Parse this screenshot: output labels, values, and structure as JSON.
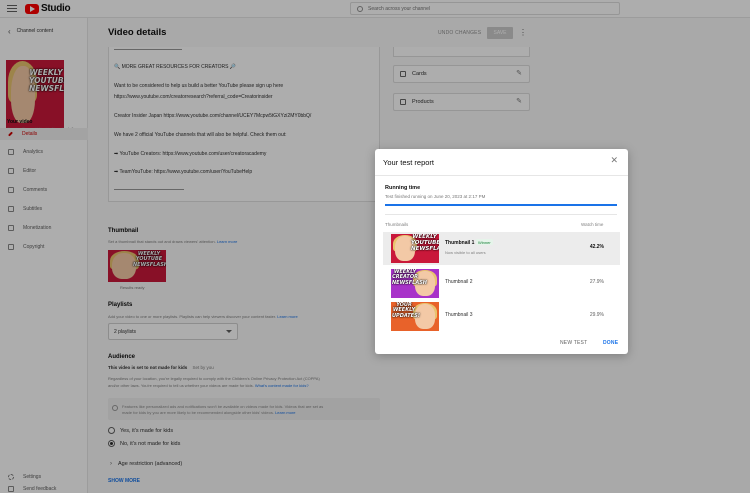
{
  "app": {
    "logo_text": "Studio",
    "search_placeholder": "Search across your channel"
  },
  "sidebar": {
    "back_label": "Channel content",
    "your_video": "Your video",
    "channel_name": "Creator Channel Weekly Newsflash & Updates",
    "items": [
      {
        "label": "Details",
        "icon": "pencil-icon"
      },
      {
        "label": "Analytics",
        "icon": "analytics-icon"
      },
      {
        "label": "Editor",
        "icon": "editor-icon"
      },
      {
        "label": "Comments",
        "icon": "comments-icon"
      },
      {
        "label": "Subtitles",
        "icon": "subtitles-icon"
      },
      {
        "label": "Monetization",
        "icon": "monetization-icon"
      },
      {
        "label": "Copyright",
        "icon": "copyright-icon"
      }
    ],
    "settings": "Settings",
    "feedback": "Send feedback"
  },
  "header": {
    "title": "Video details",
    "undo": "UNDO CHANGES",
    "save": "SAVE"
  },
  "description_lines": [
    "🔍 MORE GREAT RESOURCES FOR CREATORS 🔎",
    "Want to be considered to help us build a better YouTube please sign up here",
    "https://www.youtube.com/creatorresearch?referral_code=Creatorinsider",
    "Creator Insider Japan https://www.youtube.com/channel/UCEY7Mcpw5tGXYzi2MY0bbQ/",
    "We have 2 official YouTube channels that will also be helpful. Check them out:",
    "➡ YouTube Creators: https://www.youtube.com/user/creatoracademy",
    "➡ TeamYouTube: https://www.youtube.com/user/YouTubeHelp"
  ],
  "thumbnail": {
    "title": "Thumbnail",
    "desc": "Set a thumbnail that stands out and draws viewers' attention.",
    "learn_more": "Learn more",
    "caption": "Results ready",
    "text": "WEEKLY YOUTUBE NEWSFLASH"
  },
  "playlists": {
    "title": "Playlists",
    "desc": "Add your video to one or more playlists. Playlists can help viewers discover your content faster.",
    "learn_more": "Learn more",
    "selected": "2 playlists"
  },
  "audience": {
    "title": "Audience",
    "status": "This video is set to not made for kids",
    "set_by": "Set by you",
    "desc_line1": "Regardless of your location, you're legally required to comply with the Children's Online Privacy Protection Act (COPPA)",
    "desc_line2": "and/or other laws. You're required to tell us whether your videos are made for kids.",
    "desc_link": "What's content made for kids?",
    "notice_line1": "Features like personalized ads and notifications won't be available on videos made for kids. Videos that are set as",
    "notice_line2": "made for kids by you are more likely to be recommended alongside other kids' videos.",
    "notice_link": "Learn more",
    "option_yes": "Yes, it's made for kids",
    "option_no": "No, it's not made for kids",
    "age_restriction": "Age restriction (advanced)",
    "show_more": "SHOW MORE"
  },
  "right_cards": [
    {
      "label": "Cards",
      "icon": "cards-icon"
    },
    {
      "label": "Products",
      "icon": "products-icon"
    }
  ],
  "dialog": {
    "title": "Your test report",
    "running_label": "Running time",
    "running_sub": "Test finished running on June 20, 2023 at 2:17 PM",
    "progress": 1.0,
    "col_thumbnails": "Thumbnails",
    "col_watch_time": "Watch time",
    "rows": [
      {
        "name": "Thumbnail 1",
        "badge": "Winner",
        "sub": "Now visible to all users",
        "pct": "42.2%",
        "text": "WEEKLY YOUTUBE NEWSFLASH",
        "bg": "#c9183a"
      },
      {
        "name": "Thumbnail 2",
        "badge": "",
        "sub": "",
        "pct": "27.9%",
        "text": "WEEKLY CREATOR NEWSFLASH",
        "bg": "#a832c9"
      },
      {
        "name": "Thumbnail 3",
        "badge": "",
        "sub": "",
        "pct": "29.9%",
        "text": "YOUR WEEKLY UPDATES!",
        "bg": "#e8622a"
      }
    ],
    "new_test": "NEW TEST",
    "done": "DONE"
  },
  "colors": {
    "accent": "#1a73e8",
    "brand": "#ff0000",
    "winner": "#188038"
  }
}
